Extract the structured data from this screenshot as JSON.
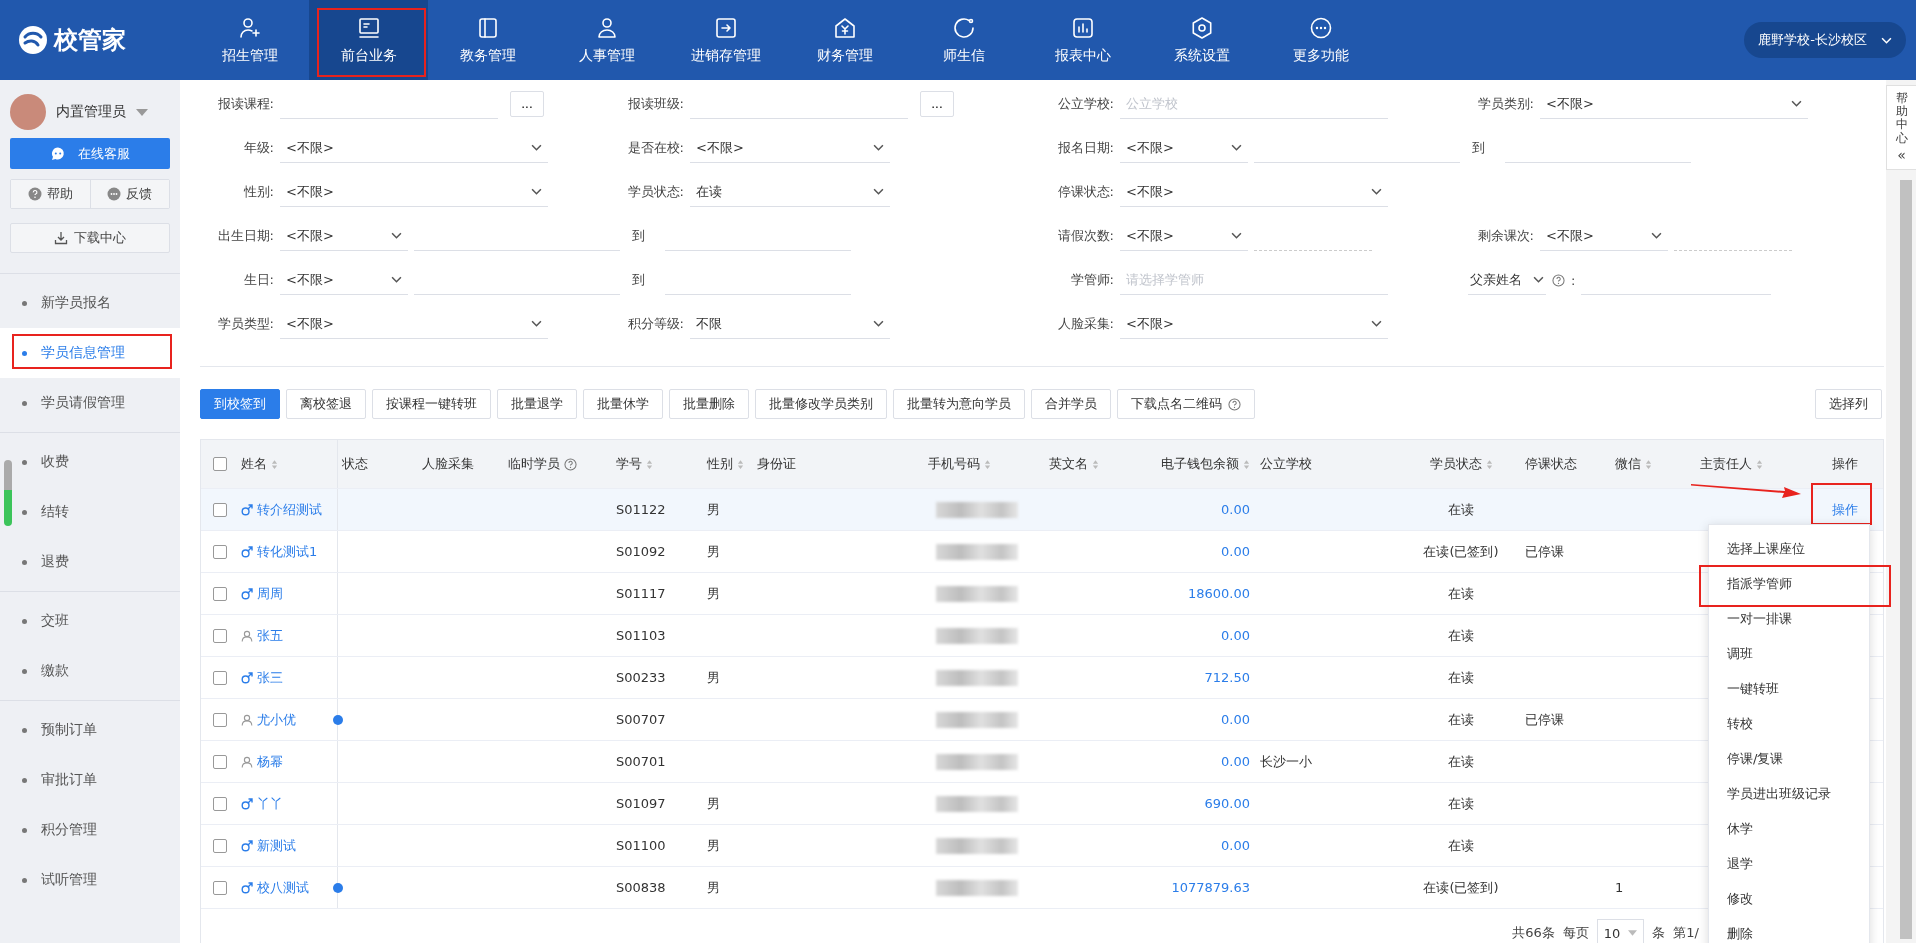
{
  "logo": {
    "text": "校管家"
  },
  "nav": [
    {
      "label": "招生管理",
      "selected": false,
      "annotated": false
    },
    {
      "label": "前台业务",
      "selected": true,
      "annotated": true
    },
    {
      "label": "教务管理",
      "selected": false,
      "annotated": false
    },
    {
      "label": "人事管理",
      "selected": false,
      "annotated": false
    },
    {
      "label": "进销存管理",
      "selected": false,
      "annotated": false
    },
    {
      "label": "财务管理",
      "selected": false,
      "annotated": false
    },
    {
      "label": "师生信",
      "selected": false,
      "annotated": false
    },
    {
      "label": "报表中心",
      "selected": false,
      "annotated": false
    },
    {
      "label": "系统设置",
      "selected": false,
      "annotated": false
    },
    {
      "label": "更多功能",
      "selected": false,
      "annotated": false
    }
  ],
  "school_selector": {
    "value": "鹿野学校-长沙校区"
  },
  "user": {
    "name": "内置管理员"
  },
  "sidebar_buttons": {
    "service": "在线客服",
    "help": "帮助",
    "feedback": "反馈",
    "download": "下载中心"
  },
  "sidebar_groups": [
    {
      "items": [
        {
          "label": "新学员报名",
          "selected": false,
          "annotated": false
        },
        {
          "label": "学员信息管理",
          "selected": true,
          "annotated": true
        },
        {
          "label": "学员请假管理",
          "selected": false,
          "annotated": false
        }
      ]
    },
    {
      "items": [
        {
          "label": "收费",
          "selected": false,
          "annotated": false
        },
        {
          "label": "结转",
          "selected": false,
          "annotated": false
        },
        {
          "label": "退费",
          "selected": false,
          "annotated": false
        }
      ]
    },
    {
      "items": [
        {
          "label": "交班",
          "selected": false,
          "annotated": false
        },
        {
          "label": "缴款",
          "selected": false,
          "annotated": false
        }
      ]
    },
    {
      "items": [
        {
          "label": "预制订单",
          "selected": false,
          "annotated": false
        },
        {
          "label": "审批订单",
          "selected": false,
          "annotated": false
        },
        {
          "label": "积分管理",
          "selected": false,
          "annotated": false
        },
        {
          "label": "试听管理",
          "selected": false,
          "annotated": false
        }
      ]
    }
  ],
  "help_tab": {
    "text": "帮助中心",
    "collapse": "«"
  },
  "filter_rows": [
    {
      "fields": [
        {
          "kind": "input_button",
          "label": "报读课程:",
          "button": "..."
        },
        {
          "kind": "input_button",
          "label": "报读班级:",
          "button": "..."
        },
        {
          "kind": "input",
          "label": "公立学校:",
          "placeholder": "公立学校"
        },
        {
          "kind": "select",
          "label": "学员类别:",
          "value": "<不限>"
        }
      ]
    },
    {
      "fields": [
        {
          "kind": "select",
          "label": "年级:",
          "value": "<不限>"
        },
        {
          "kind": "select",
          "label": "是否在校:",
          "value": "<不限>"
        },
        {
          "kind": "range",
          "label": "报名日期:",
          "value": "<不限>",
          "connector": "到"
        }
      ]
    },
    {
      "fields": [
        {
          "kind": "select",
          "label": "性别:",
          "value": "<不限>"
        },
        {
          "kind": "select",
          "label": "学员状态:",
          "value": "在读"
        },
        {
          "kind": "select",
          "label": "停课状态:",
          "value": "<不限>"
        }
      ]
    },
    {
      "fields": [
        {
          "kind": "range",
          "label": "出生日期:",
          "value": "<不限>",
          "connector": "到"
        },
        {
          "kind": "count",
          "label": "请假次数:",
          "value": "<不限>"
        },
        {
          "kind": "count",
          "label": "剩余课次:",
          "value": "<不限>"
        }
      ]
    },
    {
      "fields": [
        {
          "kind": "range",
          "label": "生日:",
          "value": "<不限>",
          "connector": "到"
        },
        {
          "kind": "input",
          "label": "学管师:",
          "placeholder": "请选择学管师"
        },
        {
          "kind": "select_input",
          "select": "父亲姓名",
          "colon": ":"
        }
      ]
    },
    {
      "fields": [
        {
          "kind": "select",
          "label": "学员类型:",
          "value": "<不限>"
        },
        {
          "kind": "select",
          "label": "积分等级:",
          "value": "不限"
        },
        {
          "kind": "select",
          "label": "人脸采集:",
          "value": "<不限>"
        }
      ]
    }
  ],
  "toolbar": {
    "buttons": [
      {
        "label": "到校签到",
        "primary": true,
        "help": false
      },
      {
        "label": "离校签退",
        "primary": false,
        "help": false
      },
      {
        "label": "按课程一键转班",
        "primary": false,
        "help": false
      },
      {
        "label": "批量退学",
        "primary": false,
        "help": false
      },
      {
        "label": "批量休学",
        "primary": false,
        "help": false
      },
      {
        "label": "批量删除",
        "primary": false,
        "help": false
      },
      {
        "label": "批量修改学员类别",
        "primary": false,
        "help": false
      },
      {
        "label": "批量转为意向学员",
        "primary": false,
        "help": false
      },
      {
        "label": "合并学员",
        "primary": false,
        "help": false
      },
      {
        "label": "下载点名二维码",
        "primary": false,
        "help": true
      }
    ],
    "column_button": "选择列"
  },
  "table": {
    "select_all_checked": false,
    "columns": [
      {
        "label": "姓名",
        "sortable": true,
        "help": false
      },
      {
        "label": "状态",
        "sortable": false,
        "help": false
      },
      {
        "label": "人脸采集",
        "sortable": false,
        "help": false
      },
      {
        "label": "临时学员",
        "sortable": false,
        "help": true
      },
      {
        "label": "学号",
        "sortable": true,
        "help": false
      },
      {
        "label": "性别",
        "sortable": true,
        "help": false
      },
      {
        "label": "身份证",
        "sortable": false,
        "help": false
      },
      {
        "label": "手机号码",
        "sortable": true,
        "help": false
      },
      {
        "label": "英文名",
        "sortable": true,
        "help": false
      },
      {
        "label": "电子钱包余额",
        "sortable": true,
        "help": false
      },
      {
        "label": "公立学校",
        "sortable": false,
        "help": false
      },
      {
        "label": "学员状态",
        "sortable": true,
        "help": false
      },
      {
        "label": "停课状态",
        "sortable": false,
        "help": false
      },
      {
        "label": "微信",
        "sortable": true,
        "help": false
      },
      {
        "label": "主责任人",
        "sortable": true,
        "help": false
      },
      {
        "label": "操作",
        "sortable": false,
        "help": false
      }
    ],
    "rows": [
      {
        "checked": false,
        "highlighted": true,
        "kind": "male",
        "name": "转介绍测试",
        "flag": false,
        "student_no": "S01122",
        "gender": "男",
        "balance": "0.00",
        "status": "在读",
        "action": "操作",
        "action_annotated": true
      },
      {
        "checked": false,
        "highlighted": false,
        "kind": "male",
        "name": "转化测试1",
        "flag": false,
        "student_no": "S01092",
        "gender": "男",
        "balance": "0.00",
        "status": "在读(已签到)",
        "suspended": "已停课"
      },
      {
        "checked": false,
        "highlighted": false,
        "kind": "male",
        "name": "周周",
        "flag": false,
        "student_no": "S01117",
        "gender": "男",
        "balance": "18600.00",
        "status": "在读"
      },
      {
        "checked": false,
        "highlighted": false,
        "kind": "person",
        "name": "张五",
        "flag": false,
        "student_no": "S01103",
        "balance": "0.00",
        "status": "在读"
      },
      {
        "checked": false,
        "highlighted": false,
        "kind": "male",
        "name": "张三",
        "flag": false,
        "student_no": "S00233",
        "gender": "男",
        "balance": "712.50",
        "status": "在读"
      },
      {
        "checked": false,
        "highlighted": false,
        "kind": "person",
        "name": "尤小优",
        "flag": true,
        "student_no": "S00707",
        "balance": "0.00",
        "status": "在读",
        "suspended": "已停课"
      },
      {
        "checked": false,
        "highlighted": false,
        "kind": "person",
        "name": "杨幂",
        "flag": false,
        "student_no": "S00701",
        "balance": "0.00",
        "school": "长沙一小",
        "status": "在读"
      },
      {
        "checked": false,
        "highlighted": false,
        "kind": "male",
        "name": "丫丫",
        "flag": false,
        "student_no": "S01097",
        "gender": "男",
        "balance": "690.00",
        "status": "在读"
      },
      {
        "checked": false,
        "highlighted": false,
        "kind": "male",
        "name": "新测试",
        "flag": false,
        "student_no": "S01100",
        "gender": "男",
        "balance": "0.00",
        "status": "在读"
      },
      {
        "checked": false,
        "highlighted": false,
        "kind": "male",
        "name": "校八测试",
        "flag": true,
        "student_no": "S00838",
        "gender": "男",
        "balance": "1077879.63",
        "status": "在读(已签到)",
        "wechat": "1"
      }
    ]
  },
  "pagination": {
    "total": "共66条",
    "per_page_label": "每页",
    "per_page": "10",
    "unit": "条",
    "page": "第1/"
  },
  "action_menu": {
    "items": [
      {
        "label": "选择上课座位",
        "annotated": false
      },
      {
        "label": "指派学管师",
        "annotated": true
      },
      {
        "label": "一对一排课",
        "annotated": false
      },
      {
        "label": "调班",
        "annotated": false
      },
      {
        "label": "一键转班",
        "annotated": false
      },
      {
        "label": "转校",
        "annotated": false
      },
      {
        "label": "停课/复课",
        "annotated": false
      },
      {
        "label": "学员进出班级记录",
        "annotated": false
      },
      {
        "label": "休学",
        "annotated": false
      },
      {
        "label": "退学",
        "annotated": false
      },
      {
        "label": "修改",
        "annotated": false
      },
      {
        "label": "删除",
        "annotated": false
      }
    ]
  }
}
